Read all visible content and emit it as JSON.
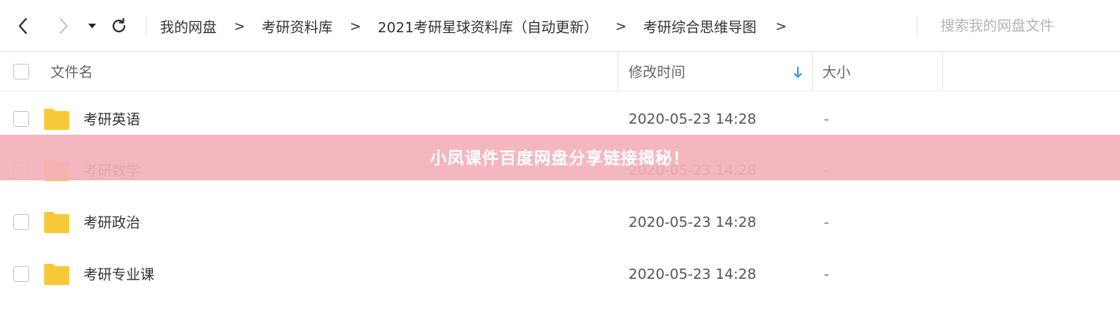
{
  "toolbar": {
    "breadcrumb": [
      "我的网盘",
      "考研资料库",
      "2021考研星球资料库（自动更新）",
      "考研综合思维导图"
    ],
    "separator": ">",
    "search_placeholder": "搜索我的网盘文件"
  },
  "table": {
    "columns": {
      "name": "文件名",
      "modified": "修改时间",
      "size": "大小"
    },
    "sort": {
      "column": "modified",
      "direction": "descending"
    },
    "rows": [
      {
        "name": "考研英语",
        "modified": "2020-05-23 14:28",
        "size": "-"
      },
      {
        "name": "考研数学",
        "modified": "2020-05-23 14:28",
        "size": "-"
      },
      {
        "name": "考研政治",
        "modified": "2020-05-23 14:28",
        "size": "-"
      },
      {
        "name": "考研专业课",
        "modified": "2020-05-23 14:28",
        "size": "-"
      }
    ]
  },
  "banner": {
    "text": "小凤课件百度网盘分享链接揭秘！"
  },
  "icons": {
    "back": "chevron-left-icon",
    "forward": "chevron-right-icon",
    "dropdown": "caret-down-icon",
    "refresh": "refresh-icon",
    "sort": "arrow-down-icon",
    "folder": "folder-icon"
  },
  "colors": {
    "folder": "#f7c93a",
    "sort_arrow": "#3b95f0",
    "banner": "#f4b1ba"
  }
}
